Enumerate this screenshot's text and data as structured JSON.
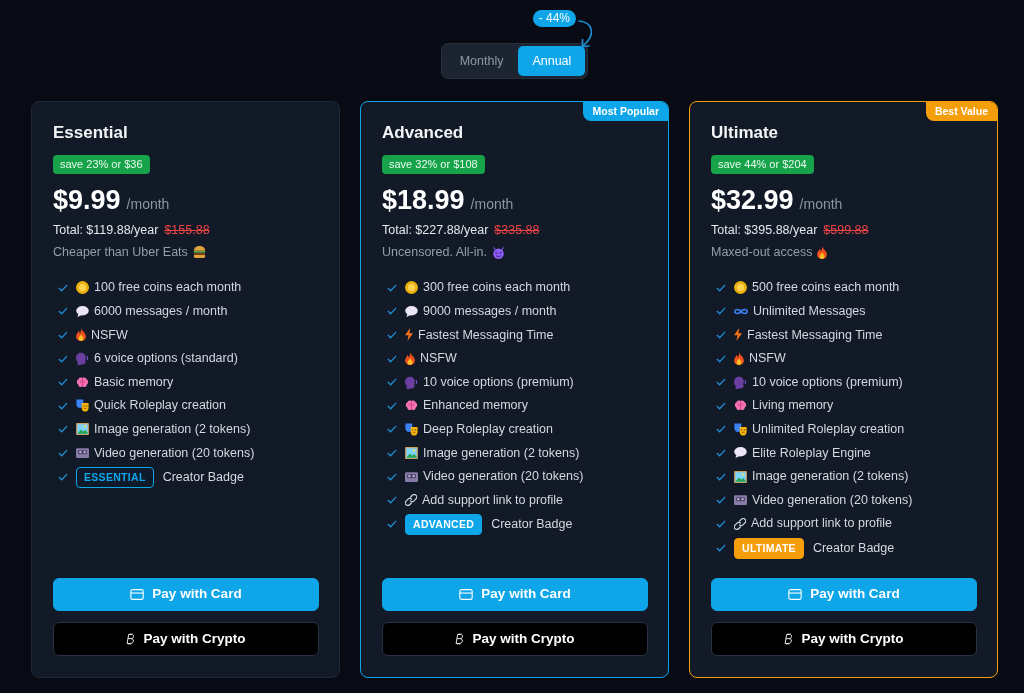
{
  "billing": {
    "discount": "- 44%",
    "options": [
      {
        "label": "Monthly",
        "selected": false
      },
      {
        "label": "Annual",
        "selected": true
      }
    ]
  },
  "plans": [
    {
      "name": "Essential",
      "save": "save 23% or $36",
      "price": "$9.99",
      "period": "/month",
      "total": "Total: $119.88/year",
      "original_total": "$155.88",
      "tagline": {
        "text": "Cheaper than Uber Eats",
        "kind": "burger"
      },
      "features": [
        {
          "kind": "coin",
          "text": "100 free coins each month"
        },
        {
          "kind": "chat",
          "text": "6000 messages / month"
        },
        {
          "kind": "fire",
          "text": "NSFW"
        },
        {
          "kind": "voice",
          "text": "6 voice options (standard)"
        },
        {
          "kind": "brain",
          "text": "Basic memory"
        },
        {
          "kind": "masks",
          "text": "Quick Roleplay creation"
        },
        {
          "kind": "image",
          "text": "Image generation (2 tokens)"
        },
        {
          "kind": "video",
          "text": "Video generation (20 tokens)"
        },
        {
          "kind": "badge",
          "tag": "ESSENTIAL",
          "color": "#0ea5e9",
          "outlined": true,
          "text": "Creator Badge"
        }
      ],
      "buttons": [
        {
          "kind": "card",
          "label": "Pay with Card"
        },
        {
          "kind": "crypto",
          "label": "Pay with Crypto"
        }
      ]
    },
    {
      "name": "Advanced",
      "ribbon": {
        "text": "Most Popular",
        "color": "#0ea5e9"
      },
      "save": "save 32% or $108",
      "price": "$18.99",
      "period": "/month",
      "total": "Total: $227.88/year",
      "original_total": "$335.88",
      "tagline": {
        "text": "Uncensored. All-in.",
        "kind": "devil"
      },
      "features": [
        {
          "kind": "coin",
          "text": "300 free coins each month"
        },
        {
          "kind": "chat",
          "text": "9000 messages / month"
        },
        {
          "kind": "bolt",
          "text": "Fastest Messaging Time"
        },
        {
          "kind": "fire",
          "text": "NSFW"
        },
        {
          "kind": "voice",
          "text": "10 voice options (premium)"
        },
        {
          "kind": "brain",
          "text": "Enhanced memory"
        },
        {
          "kind": "masks",
          "text": "Deep Roleplay creation"
        },
        {
          "kind": "image",
          "text": "Image generation (2 tokens)"
        },
        {
          "kind": "video",
          "text": "Video generation (20 tokens)"
        },
        {
          "kind": "link",
          "text": "Add support link to profile"
        },
        {
          "kind": "badge",
          "tag": "ADVANCED",
          "color": "#0ea5e9",
          "outlined": false,
          "text": "Creator Badge"
        }
      ],
      "buttons": [
        {
          "kind": "card",
          "label": "Pay with Card"
        },
        {
          "kind": "crypto",
          "label": "Pay with Crypto"
        }
      ]
    },
    {
      "name": "Ultimate",
      "ribbon": {
        "text": "Best Value",
        "color": "#f59e0b"
      },
      "save": "save 44% or $204",
      "price": "$32.99",
      "period": "/month",
      "total": "Total: $395.88/year",
      "original_total": "$599.88",
      "tagline": {
        "text": "Maxed-out access",
        "kind": "fire"
      },
      "features": [
        {
          "kind": "coin",
          "text": "500 free coins each month"
        },
        {
          "kind": "infinity",
          "text": "Unlimited Messages"
        },
        {
          "kind": "bolt",
          "text": "Fastest Messaging Time"
        },
        {
          "kind": "fire",
          "text": "NSFW"
        },
        {
          "kind": "voice",
          "text": "10 voice options (premium)"
        },
        {
          "kind": "brain",
          "text": "Living memory"
        },
        {
          "kind": "masks",
          "text": "Unlimited Roleplay creation"
        },
        {
          "kind": "chat",
          "text": "Elite Roleplay Engine"
        },
        {
          "kind": "image",
          "text": "Image generation (2 tokens)"
        },
        {
          "kind": "video",
          "text": "Video generation (20 tokens)"
        },
        {
          "kind": "link",
          "text": "Add support link to profile"
        },
        {
          "kind": "badge",
          "tag": "ULTIMATE",
          "color": "#f59e0b",
          "outlined": false,
          "text": "Creator Badge"
        }
      ],
      "buttons": [
        {
          "kind": "card",
          "label": "Pay with Card"
        },
        {
          "kind": "crypto",
          "label": "Pay with Crypto"
        }
      ]
    }
  ]
}
